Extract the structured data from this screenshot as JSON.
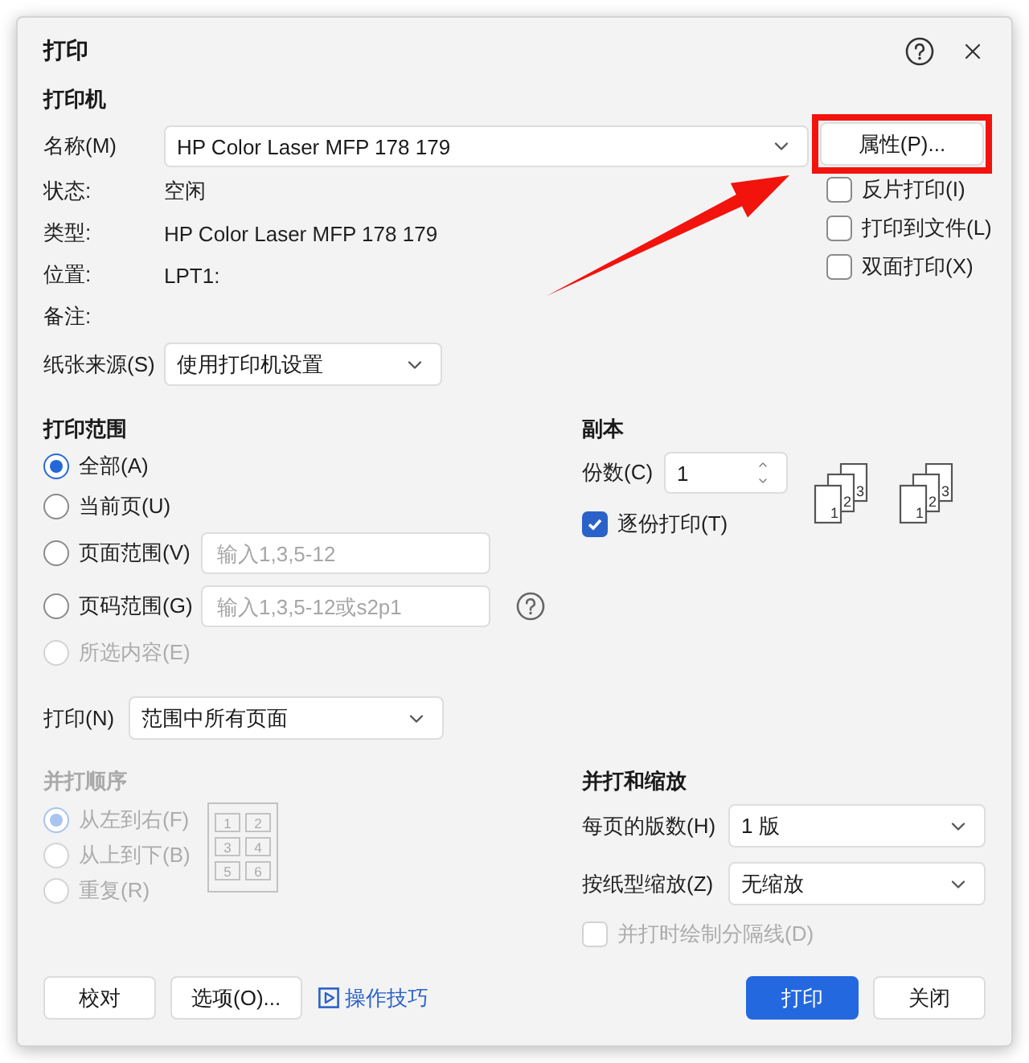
{
  "dialog": {
    "title": "打印"
  },
  "printer": {
    "heading": "打印机",
    "name_label": "名称(M)",
    "name_value": "HP Color Laser MFP 178 179",
    "properties_button": {
      "label": "属性(P)...",
      "highlighted": true
    },
    "info": [
      {
        "label": "状态:",
        "value": "空闲"
      },
      {
        "label": "类型:",
        "value": "HP Color Laser MFP 178 179"
      },
      {
        "label": "位置:",
        "value": "LPT1:"
      },
      {
        "label": "备注:"
      }
    ],
    "options": [
      {
        "label": "反片打印(I)",
        "checked": false
      },
      {
        "label": "打印到文件(L)",
        "checked": false
      },
      {
        "label": "双面打印(X)",
        "checked": false
      }
    ],
    "paper_source": {
      "label": "纸张来源(S)",
      "value": "使用打印机设置"
    }
  },
  "print_range": {
    "heading": "打印范围",
    "options": [
      {
        "label": "全部(A)",
        "selected": true,
        "disabled": false
      },
      {
        "label": "当前页(U)",
        "selected": false,
        "disabled": false
      },
      {
        "label": "页面范围(V)",
        "selected": false,
        "disabled": false,
        "placeholder": "输入1,3,5-12"
      },
      {
        "label": "页码范围(G)",
        "selected": false,
        "disabled": false,
        "placeholder": "输入1,3,5-12或s2p1",
        "help": true
      },
      {
        "label": "所选内容(E)",
        "selected": false,
        "disabled": true
      }
    ],
    "print": {
      "label": "打印(N)",
      "value": "范围中所有页面"
    }
  },
  "copies": {
    "heading": "副本",
    "count": {
      "label": "份数(C)",
      "value": "1"
    },
    "collate": {
      "label": "逐份打印(T)",
      "checked": true
    },
    "previews": [
      [
        "1",
        "2",
        "3"
      ],
      [
        "1",
        "2",
        "3"
      ]
    ]
  },
  "order": {
    "heading": "并打顺序",
    "disabled": true,
    "options": [
      {
        "label": "从左到右(F)",
        "selected": true
      },
      {
        "label": "从上到下(B)",
        "selected": false
      },
      {
        "label": "重复(R)",
        "selected": false
      }
    ],
    "preview": [
      "1",
      "2",
      "3",
      "4",
      "5",
      "6"
    ]
  },
  "scaling": {
    "heading": "并打和缩放",
    "fields": [
      {
        "label": "每页的版数(H)",
        "value": "1 版"
      },
      {
        "label": "按纸型缩放(Z)",
        "value": "无缩放"
      }
    ],
    "separator": {
      "label": "并打时绘制分隔线(D)",
      "checked": false,
      "disabled": true
    }
  },
  "footer": {
    "left": [
      {
        "label": "校对",
        "kind": "default"
      },
      {
        "label": "选项(O)...",
        "kind": "default"
      },
      {
        "label": "操作技巧",
        "kind": "link"
      }
    ],
    "right": [
      {
        "label": "打印",
        "kind": "primary"
      },
      {
        "label": "关闭",
        "kind": "default"
      }
    ]
  }
}
